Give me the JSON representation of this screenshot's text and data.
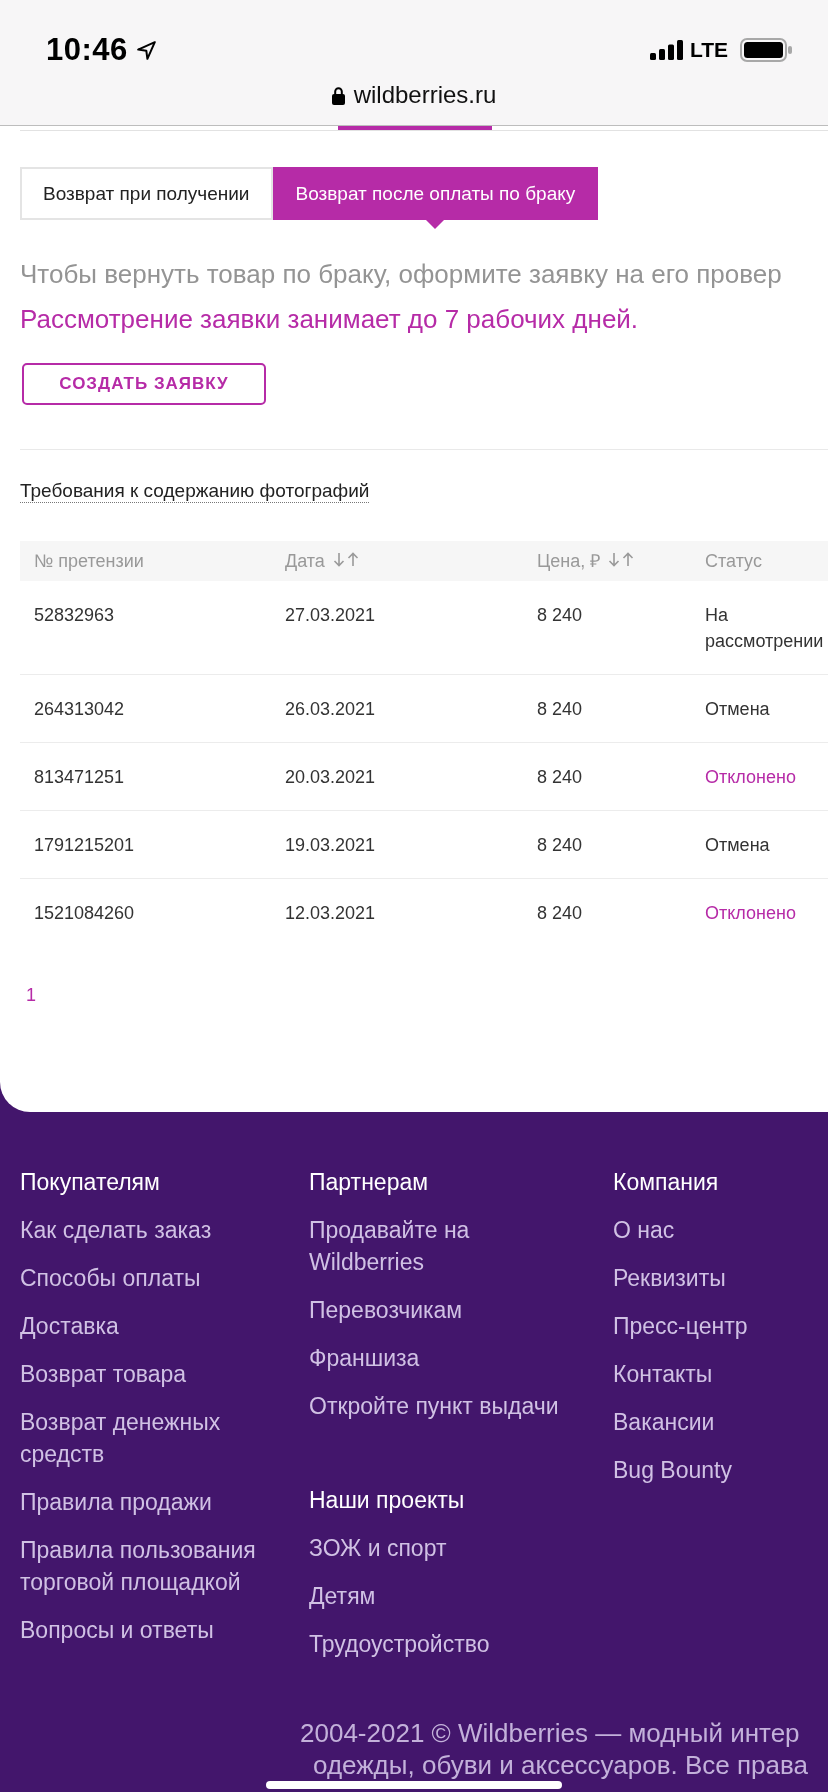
{
  "status_bar": {
    "time": "10:46",
    "network": "LTE"
  },
  "browser": {
    "url": "wildberries.ru",
    "secure": true
  },
  "tabs": [
    {
      "label": "Возврат при получении",
      "selected": false
    },
    {
      "label": "Возврат после оплаты по браку",
      "selected": true
    }
  ],
  "intro": {
    "text": "Чтобы вернуть товар по браку, оформите заявку на его провер",
    "note": "Рассмотрение заявки занимает до 7 рабочих дней."
  },
  "create_button": {
    "label": "СОЗДАТЬ ЗАЯВКУ"
  },
  "photo_requirements_link": "Требования к содержанию фотографий",
  "table": {
    "columns": [
      {
        "label": "№ претензии",
        "sortable": false
      },
      {
        "label": "Дата",
        "sortable": true
      },
      {
        "label": "Цена, ₽",
        "sortable": true
      },
      {
        "label": "Статус",
        "sortable": false
      }
    ],
    "rows": [
      {
        "number": "52832963",
        "date": "27.03.2021",
        "price": "8 240",
        "status": "На рассмотрении",
        "color": "#333333"
      },
      {
        "number": "264313042",
        "date": "26.03.2021",
        "price": "8 240",
        "status": "Отмена",
        "color": "#333333"
      },
      {
        "number": "813471251",
        "date": "20.03.2021",
        "price": "8 240",
        "status": "Отклонено",
        "color": "#b62ba7"
      },
      {
        "number": "1791215201",
        "date": "19.03.2021",
        "price": "8 240",
        "status": "Отмена",
        "color": "#333333"
      },
      {
        "number": "1521084260",
        "date": "12.03.2021",
        "price": "8 240",
        "status": "Отклонено",
        "color": "#b62ba7"
      }
    ]
  },
  "pagination": [
    {
      "label": "1",
      "selected": true
    }
  ],
  "footer": {
    "columns": [
      {
        "sections": [
          {
            "title": "Покупателям",
            "links": [
              "Как сделать заказ",
              "Способы оплаты",
              "Доставка",
              "Возврат товара",
              "Возврат денежных средств",
              "Правила продажи",
              "Правила пользования торговой площадкой",
              "Вопросы и ответы"
            ]
          }
        ]
      },
      {
        "sections": [
          {
            "title": "Партнерам",
            "links": [
              "Продавайте на Wildberries",
              "Перевозчикам",
              "Франшиза",
              "Откройте пункт выдачи"
            ]
          },
          {
            "title": "Наши проекты",
            "links": [
              "ЗОЖ и спорт",
              "Детям",
              "Трудоустройство"
            ]
          }
        ]
      },
      {
        "sections": [
          {
            "title": "Компания",
            "links": [
              "О нас",
              "Реквизиты",
              "Пресс-центр",
              "Контакты",
              "Вакансии",
              "Bug Bounty"
            ]
          }
        ]
      }
    ],
    "copyright_lines": [
      "2004-2021 © Wildberries — модный интер",
      "одежды, обуви и аксессуаров. Все права"
    ]
  }
}
